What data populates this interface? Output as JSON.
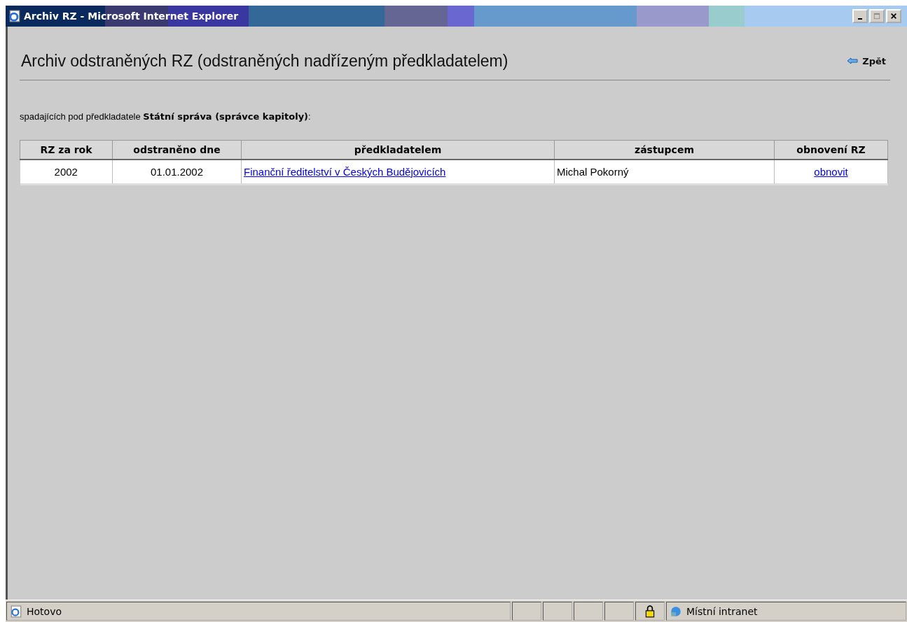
{
  "window": {
    "title": "Archiv RZ - Microsoft Internet Explorer"
  },
  "page": {
    "heading": "Archiv odstraněných RZ (odstraněných nadřízeným předkladatelem)",
    "back_link": "Zpět",
    "subtitle": "spadajících pod předkladatele **Státní správa (správce kapitoly)**:"
  },
  "table": {
    "columns": [
      "RZ za rok",
      "odstraněno dne",
      "předkladatelem",
      "zástupcem",
      "obnovení RZ"
    ],
    "rows": [
      {
        "year": "2002",
        "removed_on": "01.01.2002",
        "submitter": "Finanční ředitelství v Českých Budějovicích",
        "representative": "Michal Pokorný",
        "restore": "obnovit"
      }
    ]
  },
  "status_bar": {
    "text": "Hotovo",
    "zone": "Místní intranet"
  }
}
